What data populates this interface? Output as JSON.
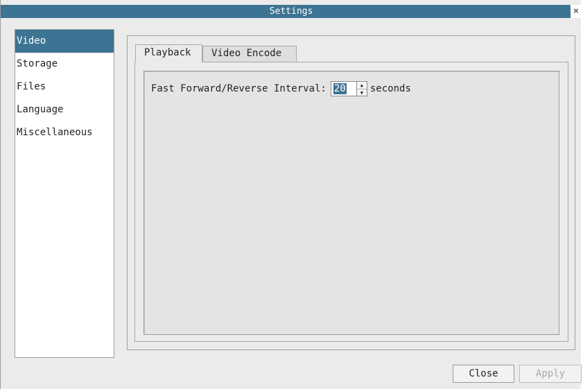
{
  "window": {
    "title": "Settings",
    "close_glyph": "×"
  },
  "sidebar": {
    "items": [
      {
        "label": "Video",
        "selected": true
      },
      {
        "label": "Storage",
        "selected": false
      },
      {
        "label": "Files",
        "selected": false
      },
      {
        "label": "Language",
        "selected": false
      },
      {
        "label": "Miscellaneous",
        "selected": false
      }
    ]
  },
  "tabs": [
    {
      "label": "Playback",
      "active": true
    },
    {
      "label": "Video Encode",
      "active": false
    }
  ],
  "playback": {
    "interval_label": "Fast Forward/Reverse Interval:",
    "interval_value": "20",
    "interval_unit": "seconds"
  },
  "buttons": {
    "close": "Close",
    "apply": "Apply"
  },
  "colors": {
    "accent": "#3d7493",
    "background": "#ebebeb"
  }
}
